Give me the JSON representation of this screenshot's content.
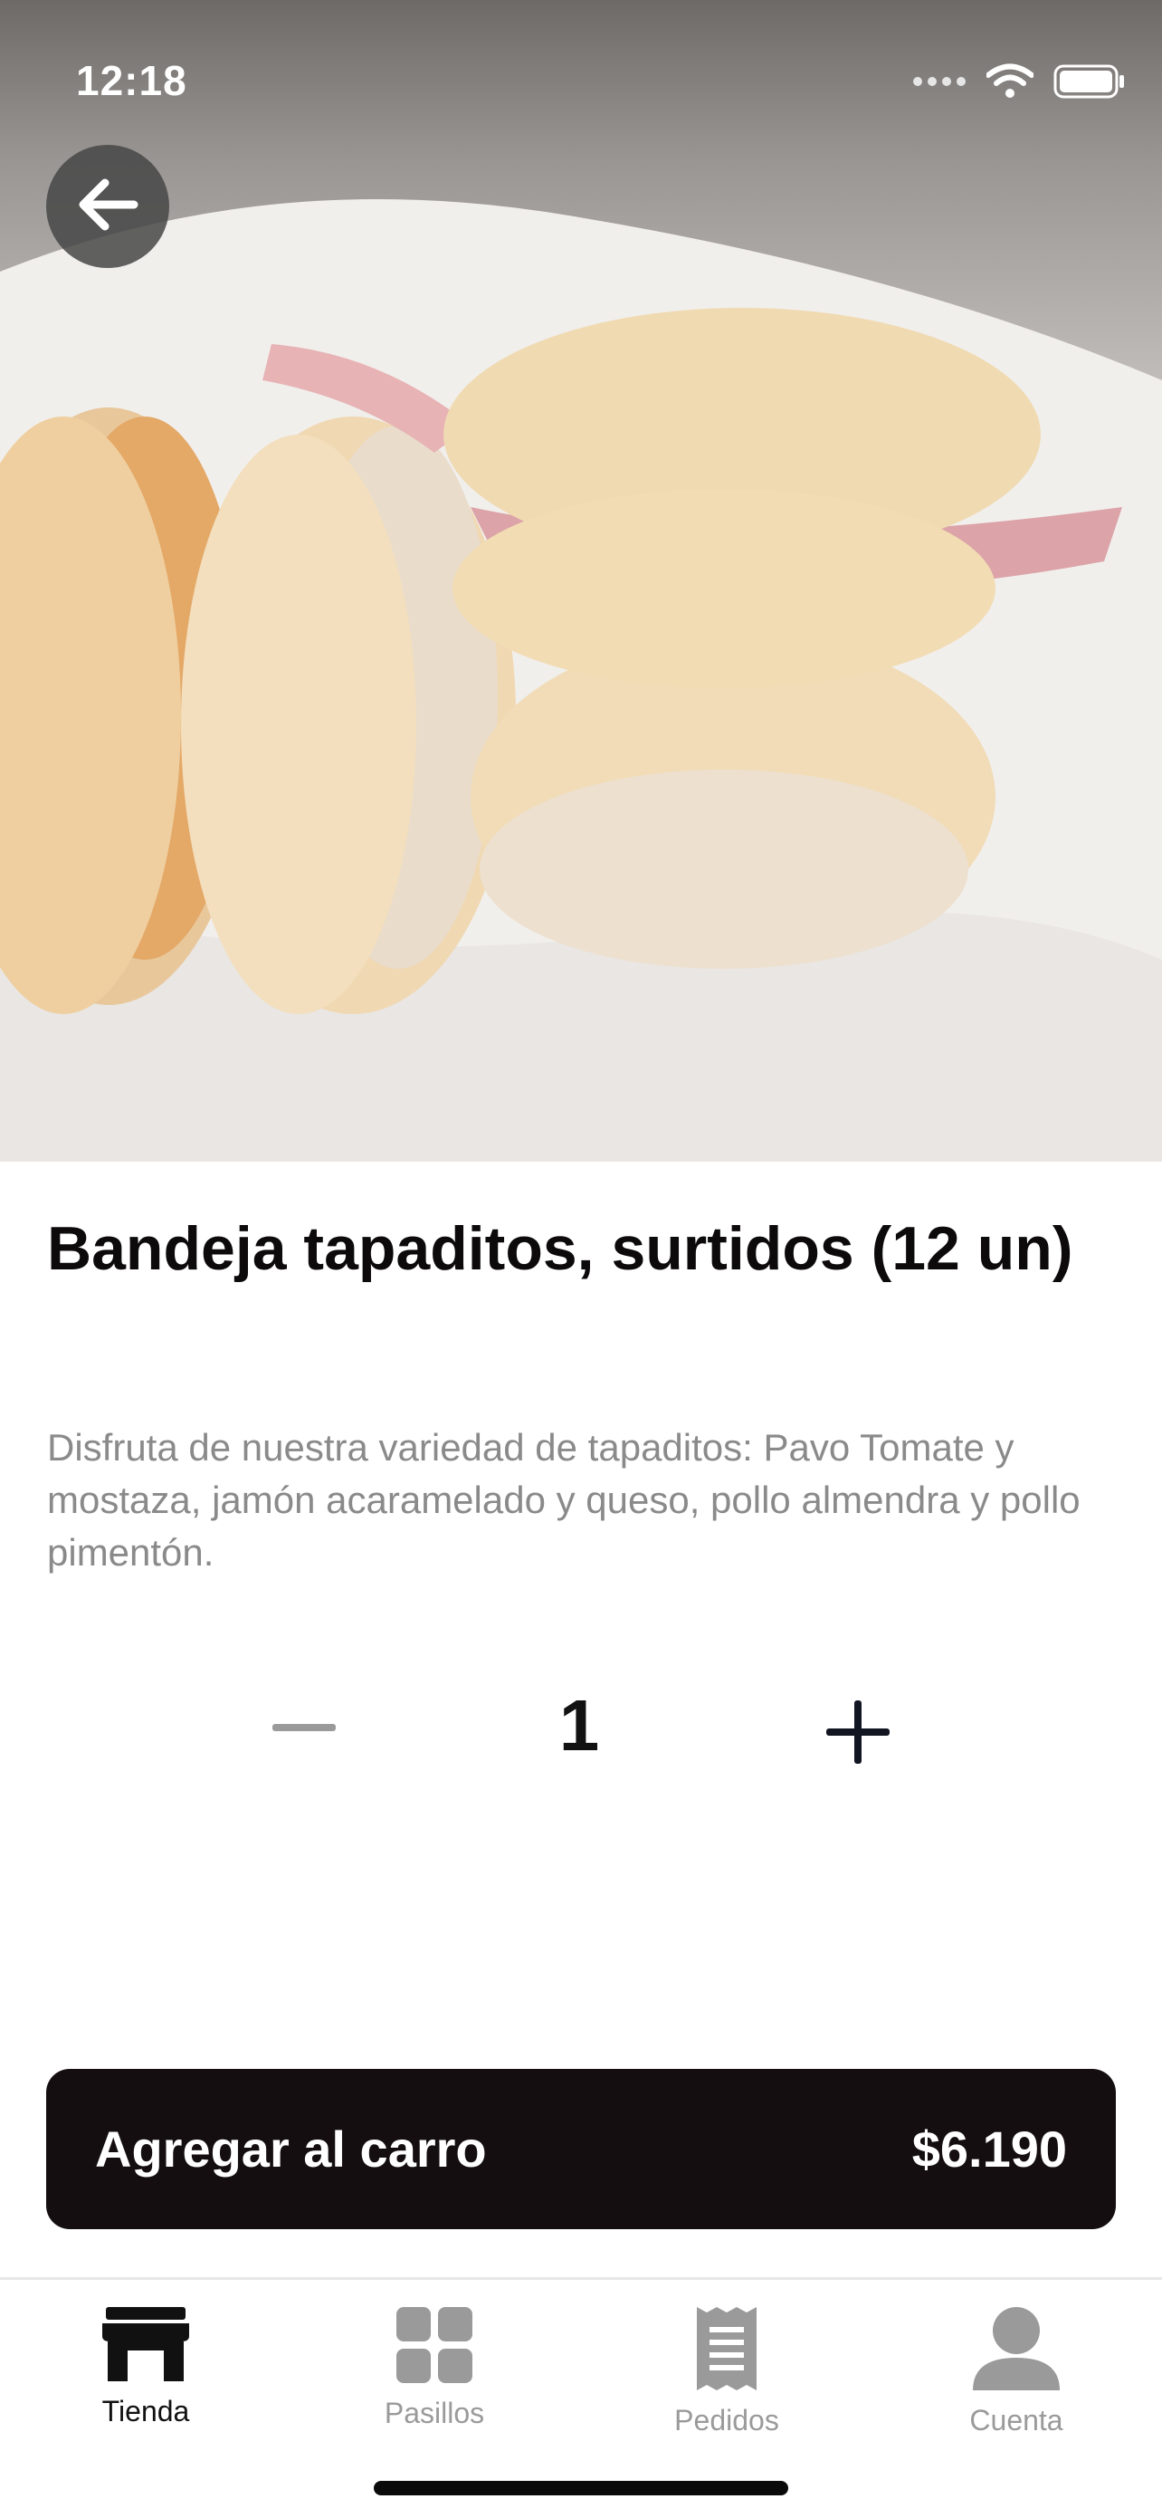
{
  "status_bar": {
    "time": "12:18"
  },
  "product": {
    "title": "Bandeja tapaditos, surtidos (12 un)",
    "description": "Disfruta de nuestra variedad de tapaditos: Pavo Tomate y mostaza, jamón acaramelado y queso, pollo almendra y pollo pimentón."
  },
  "quantity": {
    "value": "1"
  },
  "cart_button": {
    "label": "Agregar al carro",
    "price": "$6.190"
  },
  "tabs": [
    {
      "label": "Tienda",
      "icon": "store-icon",
      "active": true
    },
    {
      "label": "Pasillos",
      "icon": "grid-icon",
      "active": false
    },
    {
      "label": "Pedidos",
      "icon": "receipt-icon",
      "active": false
    },
    {
      "label": "Cuenta",
      "icon": "user-icon",
      "active": false
    }
  ],
  "colors": {
    "cart_button": "#150e10",
    "active_tab": "#111111",
    "inactive_tab": "#9a9a9a"
  }
}
